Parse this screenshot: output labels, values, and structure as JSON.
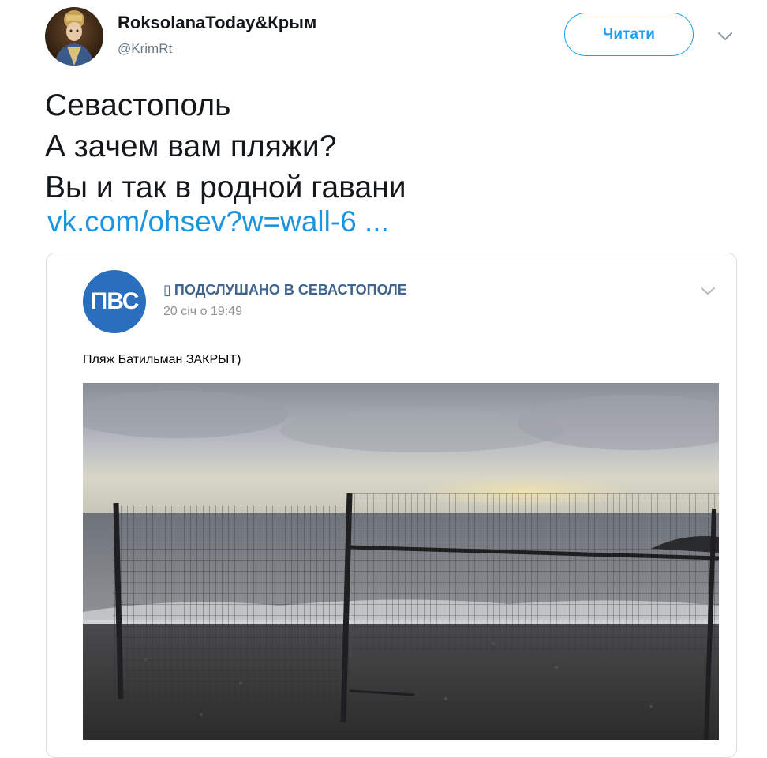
{
  "tweet": {
    "author_name": "RoksolanaToday&Крым",
    "author_handle": "@KrimRt",
    "follow_label": "Читати",
    "text_lines": [
      "Севастополь",
      "А зачем вам пляжи?",
      "Вы и так в родной гавани"
    ],
    "link_text": "vk.com/ohsev?w=wall-6 ..."
  },
  "card": {
    "avatar_text": "ПВС",
    "group_mark": "▯",
    "group_name": "ПОДСЛУШАНО В СЕВАСТОПОЛЕ",
    "date": "20 січ о 19:49",
    "post_text": "Пляж Батильман ЗАКРЫТ)"
  },
  "colors": {
    "accent": "#1da1f2",
    "link": "#1b95e0",
    "vk_blue": "#2a6fbd",
    "vk_name": "#42648b"
  },
  "icons": {
    "menu": "chevron-down-icon",
    "card_menu": "chevron-down-icon"
  }
}
